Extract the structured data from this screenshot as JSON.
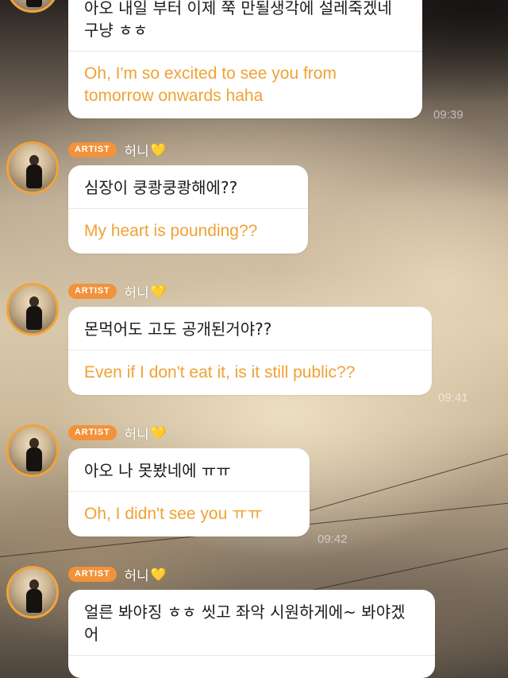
{
  "messages": [
    {
      "badge": "",
      "name": "",
      "heart": "",
      "original": "아오 내일 부터 이제 쭉 만될생각에 설레죽겠네 구냥 ㅎㅎ",
      "translation": "Oh, I'm so excited to see you from tomorrow onwards haha"
    },
    {
      "badge": "ARTIST",
      "name": "허니",
      "heart": "💛",
      "original": "심장이 쿵쾅쿵쾅해에??",
      "translation": "My heart is pounding??"
    },
    {
      "badge": "ARTIST",
      "name": "허니",
      "heart": "💛",
      "original": "몬먹어도 고도 공개된거야??",
      "translation": "Even if I don't eat it, is it still public??"
    },
    {
      "badge": "ARTIST",
      "name": "허니",
      "heart": "💛",
      "original": "아오 나 못봤네에 ㅠㅠ",
      "translation": "Oh, I didn't see you ㅠㅠ"
    },
    {
      "badge": "ARTIST",
      "name": "허니",
      "heart": "💛",
      "original": "얼른 봐야징 ㅎㅎ 씻고 좌악 시원하게에~ 봐야겠어",
      "translation": ""
    }
  ],
  "background_timestamps": [
    "09:39",
    "09:41",
    "09:42"
  ],
  "colors": {
    "accent": "#f2923a",
    "translation_text": "#f0a234",
    "bubble": "#ffffff"
  }
}
